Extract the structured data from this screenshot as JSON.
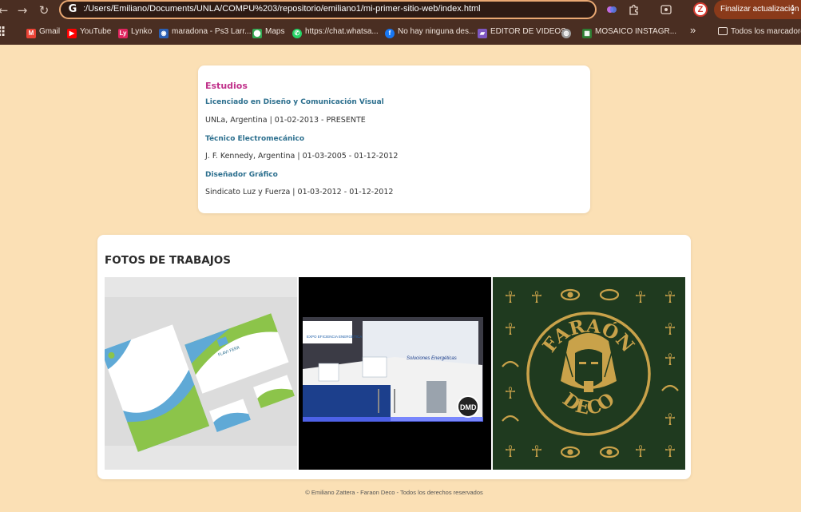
{
  "browser": {
    "url": ":/Users/Emiliano/Documents/UNLA/COMPU%203/repositorio/emiliano1/mi-primer-sitio-web/index.html",
    "update_button": "Finalizar actualización",
    "profile_letter": "Z",
    "bookmarks": [
      {
        "label": "Gmail",
        "icon": "gmail-icon",
        "color": "#ea4335"
      },
      {
        "label": "YouTube",
        "icon": "youtube-icon",
        "color": "#ff0000"
      },
      {
        "label": "Lynko",
        "icon": "lynko-icon",
        "color": "#e0245e"
      },
      {
        "label": "maradona - Ps3 Larr...",
        "icon": "ps3-icon",
        "color": "#2b5fb3"
      },
      {
        "label": "Maps",
        "icon": "maps-icon",
        "color": "#34a853"
      },
      {
        "label": "https://chat.whatsa...",
        "icon": "whatsapp-icon",
        "color": "#25d366"
      },
      {
        "label": "No hay ninguna des...",
        "icon": "facebook-icon",
        "color": "#1877f2"
      },
      {
        "label": "EDITOR DE VIDEOS",
        "icon": "video-editor-icon",
        "color": "#7e57c2"
      },
      {
        "label": "",
        "icon": "globe-icon",
        "color": "#9e9e9e"
      },
      {
        "label": "MOSAICO INSTAGR...",
        "icon": "mosaic-icon",
        "color": "#2e7d32"
      }
    ],
    "all_bookmarks": "Todos los marcadores"
  },
  "studies": {
    "heading": "Estudios",
    "entries": [
      {
        "degree": "Licenciado en Diseño y Comunicación Visual",
        "detail": "UNLa, Argentina | 01-02-2013 - PRESENTE"
      },
      {
        "degree": "Técnico Electromecánico",
        "detail": "J. F. Kennedy, Argentina | 01-03-2005 - 01-12-2012"
      },
      {
        "degree": "Diseñador Gráfico",
        "detail": "Sindicato Luz y Fuerza | 01-03-2012 - 01-12-2012"
      }
    ]
  },
  "photos": {
    "heading": "FOTOS DE TRABAJOS",
    "items": [
      {
        "subject": "stationery-mockup",
        "brand": "FLAVI FERR"
      },
      {
        "subject": "exhibition-stand",
        "brand": "DMD",
        "banner": "EXPO EFICIENCIA ENERGÉTICA",
        "slogan": "Soluciones Energéticas"
      },
      {
        "subject": "logo",
        "line1": "FARAÓN",
        "line2": "DECO"
      }
    ]
  },
  "footer": "© Emiliano Zattera - Faraon Deco - Todos los derechos reservados",
  "colors": {
    "page_bg": "#fbe0b5",
    "chrome_bg": "#4a2e22",
    "heading_pink": "#c0308a",
    "degree_blue": "#2c6f8e",
    "pharaoh_green": "#1f3a1f",
    "pharaoh_gold": "#c9a24a"
  }
}
